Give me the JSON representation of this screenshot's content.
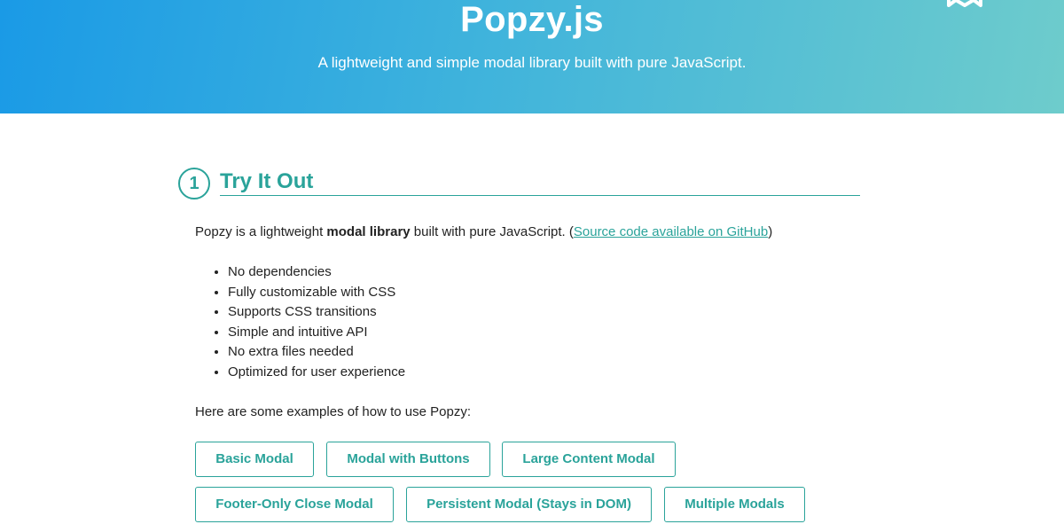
{
  "hero": {
    "title": "Popzy.js",
    "subtitle": "A lightweight and simple modal library built with pure JavaScript.",
    "corner_icon": "ribbon-icon"
  },
  "section": {
    "number": "1",
    "title": "Try It Out"
  },
  "intro": {
    "before_bold": "Popzy is a lightweight ",
    "bold": "modal library",
    "after_bold": " built with pure JavaScript. (",
    "link": "Source code available on GitHub",
    "after_link": ")"
  },
  "features": [
    "No dependencies",
    "Fully customizable with CSS",
    "Supports CSS transitions",
    "Simple and intuitive API",
    "No extra files needed",
    "Optimized for user experience"
  ],
  "examples_intro": "Here are some examples of how to use Popzy:",
  "buttons": {
    "basic": "Basic Modal",
    "with_buttons": "Modal with Buttons",
    "large_content": "Large Content Modal",
    "footer_only": "Footer-Only Close Modal",
    "persistent": "Persistent Modal (Stays in DOM)",
    "multiple": "Multiple Modals"
  },
  "colors": {
    "accent": "#2aa39a",
    "hero_start": "#1a9ae6",
    "hero_end": "#6ecccc"
  }
}
